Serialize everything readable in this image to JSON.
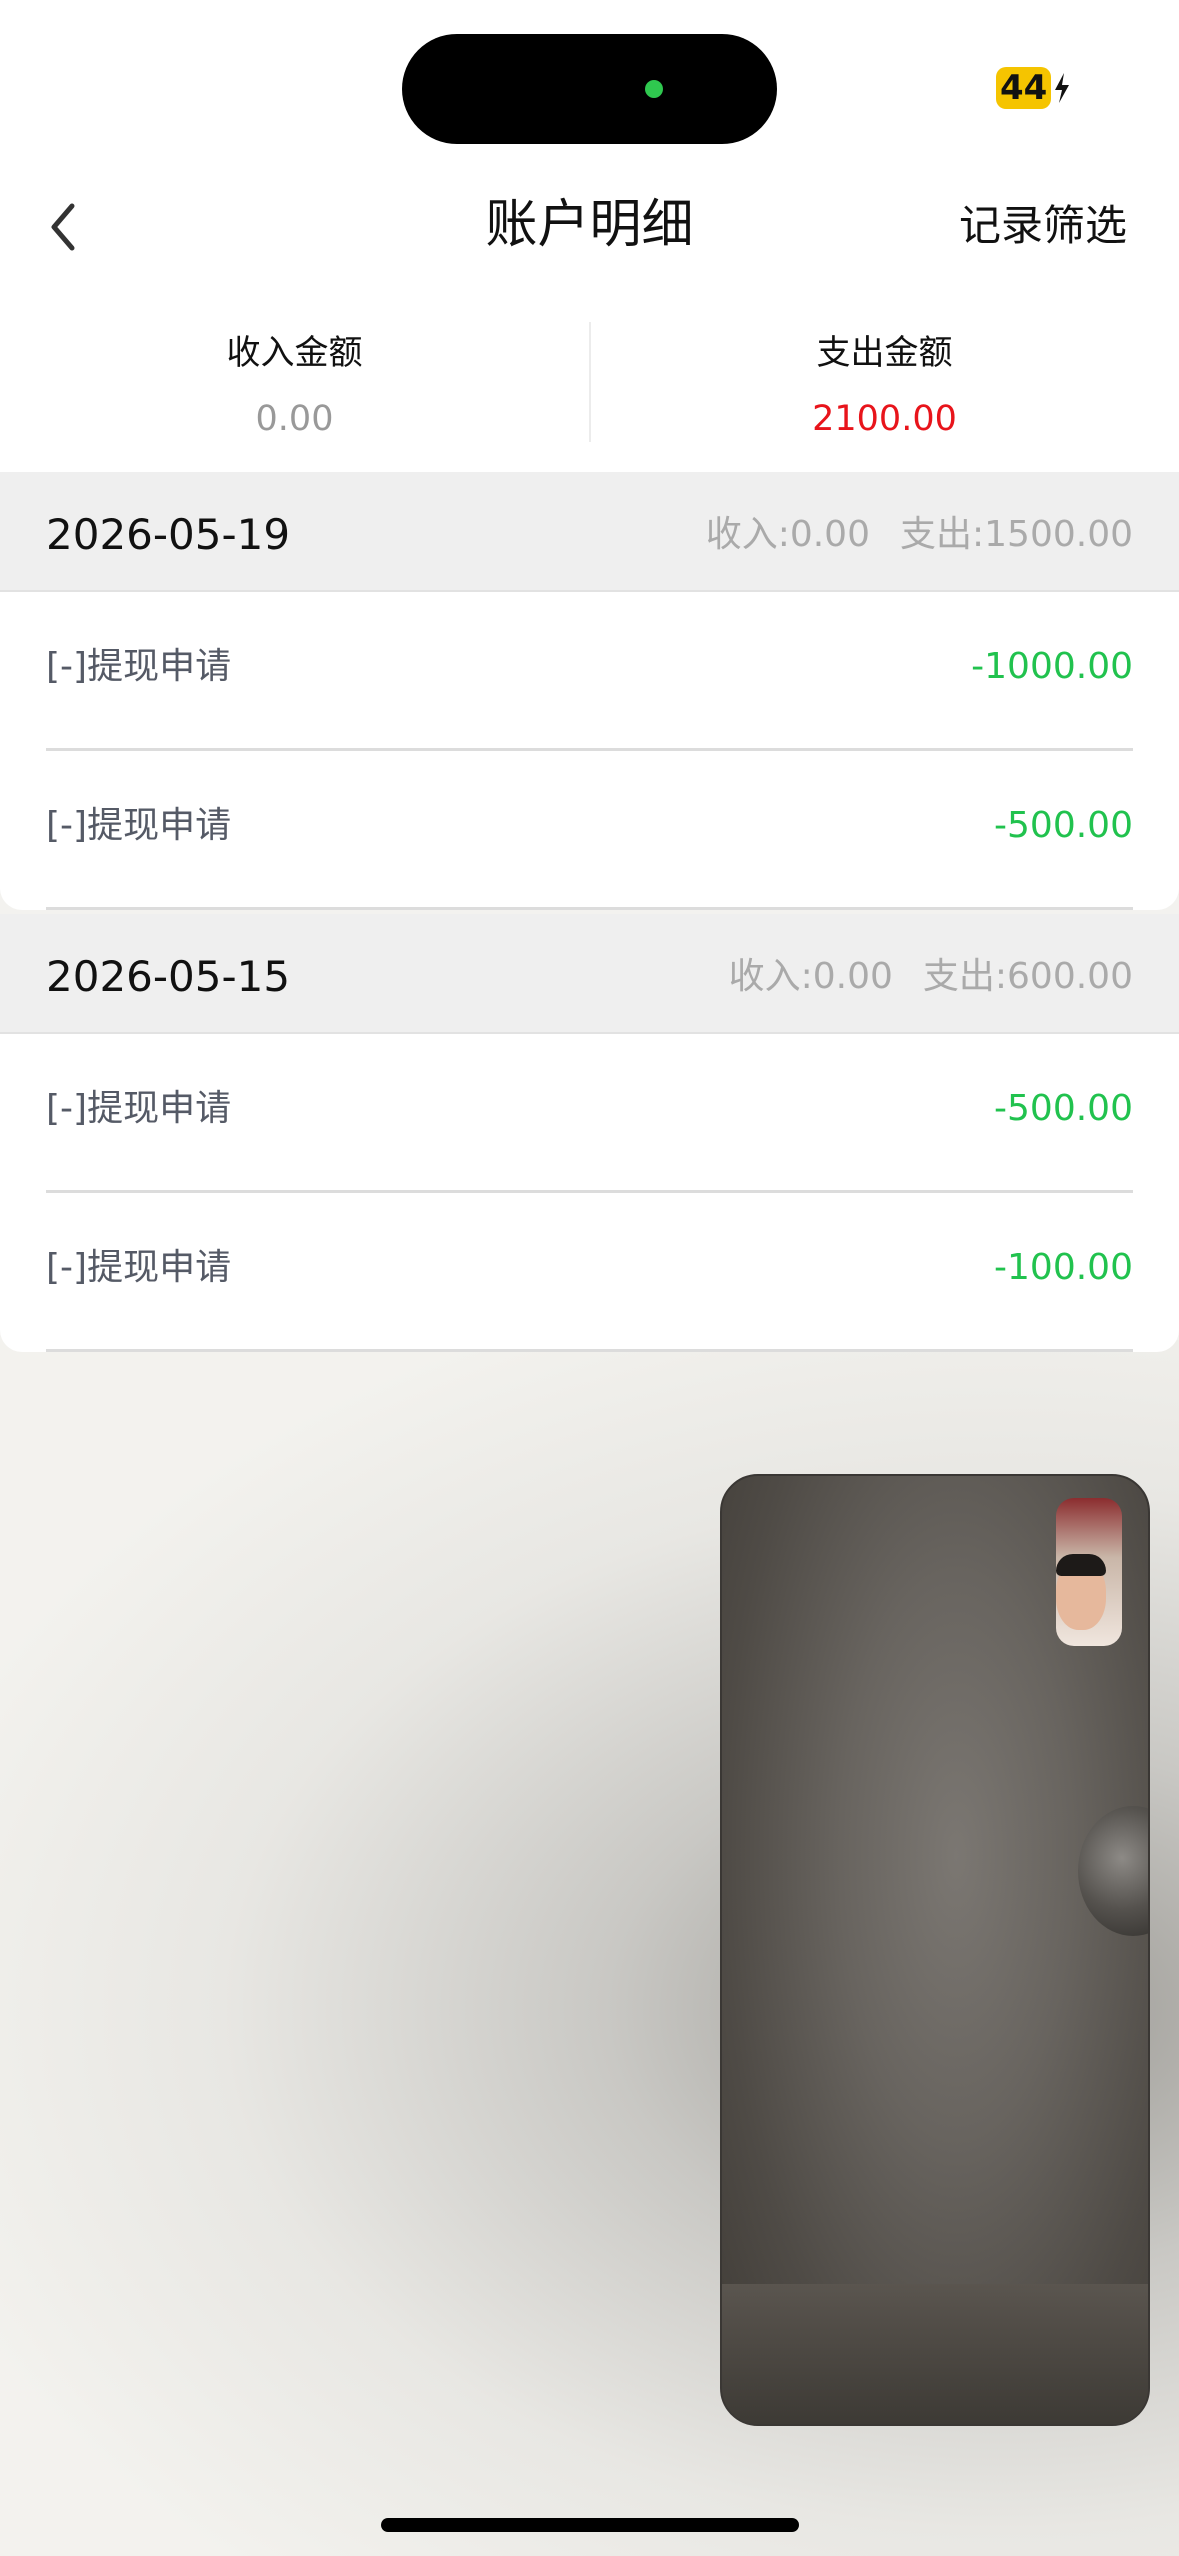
{
  "status_bar": {
    "battery_level": "44",
    "battery_accent": "#f5c400",
    "charging_icon": "bolt-icon"
  },
  "nav": {
    "back_icon": "chevron-left-icon",
    "title": "账户明细",
    "filter_label": "记录筛选"
  },
  "summary": {
    "income": {
      "label": "收入金额",
      "value": "0.00",
      "color": "#999999"
    },
    "expense": {
      "label": "支出金额",
      "value": "2100.00",
      "color": "#e8141b"
    }
  },
  "groups": [
    {
      "date": "2026-05-19",
      "income": "收入:0.00",
      "expense": "支出:1500.00",
      "items": [
        {
          "label": "[-]提现申请",
          "amount": "-1000.00"
        },
        {
          "label": "[-]提现申请",
          "amount": "-500.00"
        }
      ]
    },
    {
      "date": "2026-05-15",
      "income": "收入:0.00",
      "expense": "支出:600.00",
      "items": [
        {
          "label": "[-]提现申请",
          "amount": "-500.00"
        },
        {
          "label": "[-]提现申请",
          "amount": "-100.00"
        }
      ]
    }
  ],
  "colors": {
    "amount_negative": "#21c24e",
    "header_bg": "#efefef"
  }
}
